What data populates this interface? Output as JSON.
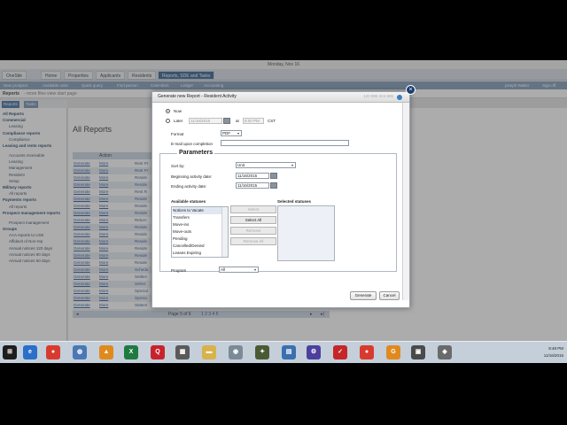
{
  "window": {
    "title": "Monday, Nov 16"
  },
  "top_tabs": [
    "OneSite",
    "Home",
    "Properties",
    "Applicants",
    "Residents",
    "Reports, SDE and Tasks"
  ],
  "subnav": {
    "items": [
      "New prospect",
      "Available units",
      "Quick query",
      "Find person",
      "Calendars",
      "Ledger",
      "Accounting"
    ],
    "user": "joseph Walter",
    "sign_off": "Sign off"
  },
  "breadcrumb": {
    "title": "Reports",
    "subtitle": "- more files view start page"
  },
  "sidebar": {
    "tabs": [
      "Reports",
      "Tasks"
    ],
    "items": [
      {
        "label": "All Reports",
        "kind": "head"
      },
      {
        "label": "Commercial",
        "kind": "head"
      },
      {
        "label": "Leasing",
        "kind": "sub"
      },
      {
        "label": "Compliance reports",
        "kind": "head"
      },
      {
        "label": "Compliance",
        "kind": "sub"
      },
      {
        "label": "Leasing and rents reports",
        "kind": "head"
      },
      {
        "label": "Accounts receivable",
        "kind": "sub"
      },
      {
        "label": "Leasing",
        "kind": "sub"
      },
      {
        "label": "Management",
        "kind": "sub"
      },
      {
        "label": "Resident",
        "kind": "sub"
      },
      {
        "label": "Setup",
        "kind": "sub"
      },
      {
        "label": "Military reports",
        "kind": "head"
      },
      {
        "label": "All reports",
        "kind": "sub"
      },
      {
        "label": "Payments reports",
        "kind": "head"
      },
      {
        "label": "All reports",
        "kind": "sub"
      },
      {
        "label": "Prospect management reports",
        "kind": "head"
      },
      {
        "label": "Prospect management",
        "kind": "sub"
      },
      {
        "label": "Groups",
        "kind": "head"
      },
      {
        "label": "AAA reports to USE",
        "kind": "sub"
      },
      {
        "label": "Affidavit of Non-rep",
        "kind": "sub"
      },
      {
        "label": "Annual notices 120 days",
        "kind": "sub"
      },
      {
        "label": "Annual notices 90 days",
        "kind": "sub"
      },
      {
        "label": "Annual notices 60 days",
        "kind": "sub"
      }
    ]
  },
  "main": {
    "title": "All Reports",
    "grid_header": "Action",
    "rows": [
      {
        "action": "Generate",
        "more": "More",
        "name": "Rent Pr"
      },
      {
        "action": "Generate",
        "more": "More",
        "name": "Rent Pr"
      },
      {
        "action": "Generate",
        "more": "More",
        "name": "Reside"
      },
      {
        "action": "Generate",
        "more": "More",
        "name": "Reside"
      },
      {
        "action": "Generate",
        "more": "More",
        "name": "Rent R"
      },
      {
        "action": "Generate",
        "more": "More",
        "name": "Reside"
      },
      {
        "action": "Generate",
        "more": "More",
        "name": "Reside"
      },
      {
        "action": "Generate",
        "more": "More",
        "name": "Reside"
      },
      {
        "action": "Generate",
        "more": "More",
        "name": "Return"
      },
      {
        "action": "Generate",
        "more": "More",
        "name": "Reside"
      },
      {
        "action": "Generate",
        "more": "More",
        "name": "Reside"
      },
      {
        "action": "Generate",
        "more": "More",
        "name": "Reside"
      },
      {
        "action": "Generate",
        "more": "More",
        "name": "Reside"
      },
      {
        "action": "Generate",
        "more": "More",
        "name": "Reside"
      },
      {
        "action": "Generate",
        "more": "More",
        "name": "Reside"
      },
      {
        "action": "Generate",
        "more": "More",
        "name": "Schedu"
      },
      {
        "action": "Generate",
        "more": "More",
        "name": "Settlen"
      },
      {
        "action": "Generate",
        "more": "More",
        "name": "Select"
      },
      {
        "action": "Generate",
        "more": "More",
        "name": "Special"
      },
      {
        "action": "Generate",
        "more": "More",
        "name": "Specia"
      },
      {
        "action": "Generate",
        "more": "More",
        "name": "Statem"
      },
      {
        "action": "Generate",
        "more": "More",
        "name": "Special"
      }
    ],
    "pager": {
      "text": "Page 5 of 6",
      "pages": "1 2 3 4 5"
    }
  },
  "dialog": {
    "title": "Generate new Report - Resident Activity",
    "extra": "120 886 324 896",
    "close": "×",
    "now_label": "Now",
    "later_label": "Later",
    "later_date": "11/16/2015",
    "at_label": "at",
    "later_time": "8:00 PM",
    "tz": "CST",
    "format_label": "Format",
    "format_value": "PDF",
    "email_label": "E-mail upon completion",
    "params_title": "Parameters",
    "sort_label": "Sort by:",
    "sort_value": "Unit",
    "begin_label": "Beginning activity date:",
    "begin_value": "11/16/2015",
    "end_label": "Ending activity date:",
    "end_value": "11/16/2015",
    "available_label": "Available statuses",
    "selected_label": "Selected statuses",
    "statuses": [
      "Notices to Vacate",
      "Transfers",
      "Move-ins",
      "Move-outs",
      "Pending",
      "Cancelled/Denied",
      "Leases Expiring"
    ],
    "btn_select": "Select",
    "btn_select_all": "Select All",
    "btn_remove": "Remove",
    "btn_remove_all": "Remove All",
    "program_label": "Program",
    "program_value": "All",
    "generate": "Generate",
    "cancel": "Cancel"
  },
  "taskbar": {
    "time": "8:48 PM",
    "date": "11/16/2015"
  },
  "colors": {
    "brand": "#2f5d8e",
    "subnav": "#7e99b8",
    "link": "#2a57a0"
  }
}
